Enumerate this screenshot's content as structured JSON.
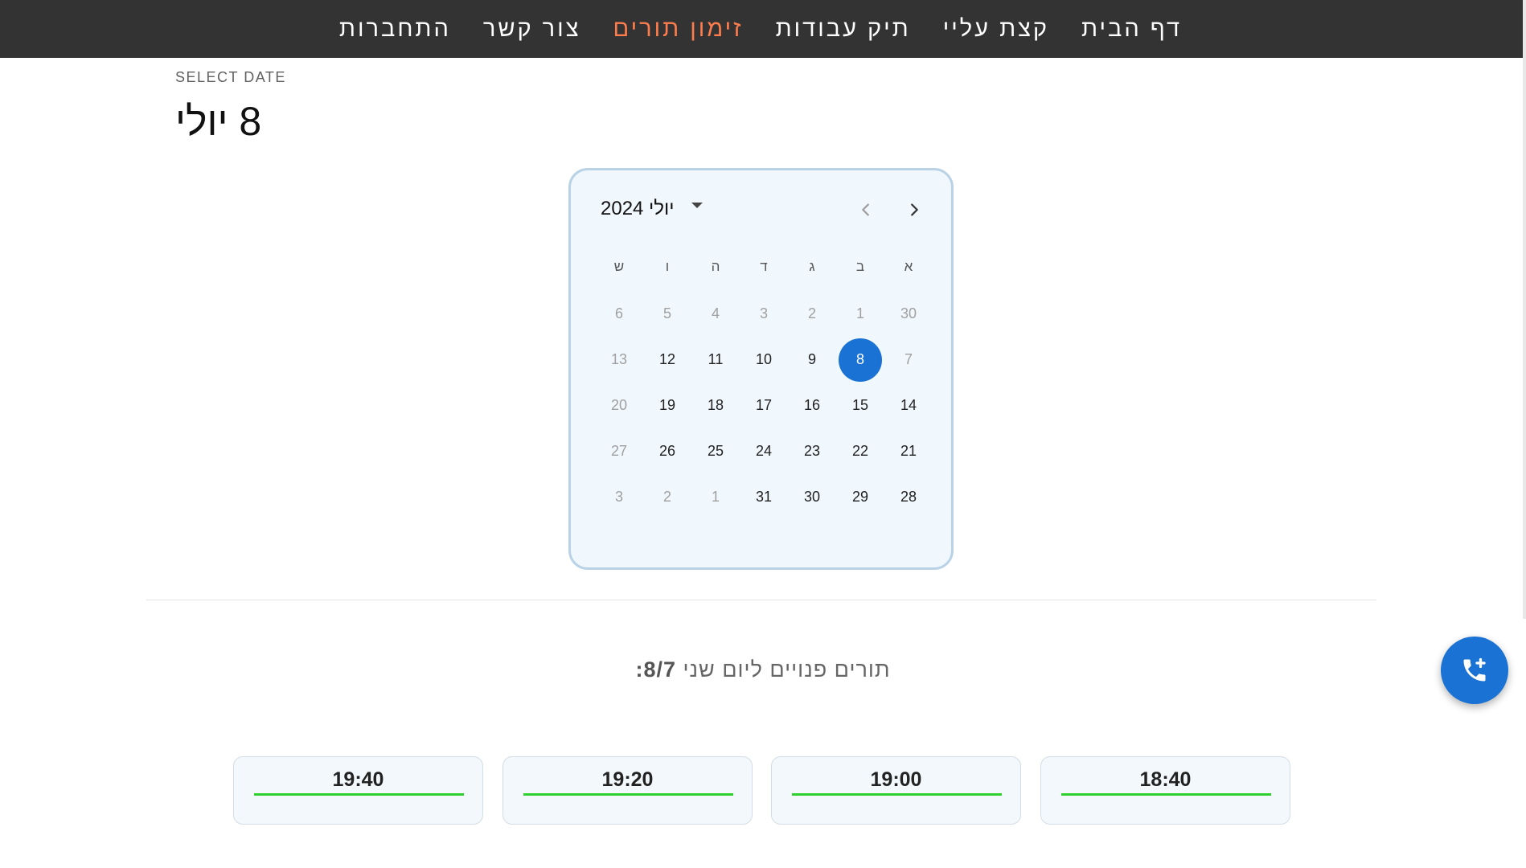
{
  "nav": {
    "items": [
      {
        "label": "דף הבית",
        "active": false
      },
      {
        "label": "קצת עליי",
        "active": false
      },
      {
        "label": "תיק עבודות",
        "active": false
      },
      {
        "label": "זימון תורים",
        "active": true
      },
      {
        "label": "צור קשר",
        "active": false
      },
      {
        "label": "התחברות",
        "active": false
      }
    ],
    "active_color": "#ff7d4d"
  },
  "header": {
    "select_label": "SELECT DATE",
    "selected_date": "8 יולי"
  },
  "calendar": {
    "month_label": "יולי 2024",
    "weekdays": [
      "א",
      "ב",
      "ג",
      "ד",
      "ה",
      "ו",
      "ש"
    ],
    "weeks": [
      [
        {
          "d": "30",
          "m": true
        },
        {
          "d": "1",
          "m": true
        },
        {
          "d": "2",
          "m": true
        },
        {
          "d": "3",
          "m": true
        },
        {
          "d": "4",
          "m": true
        },
        {
          "d": "5",
          "m": true
        },
        {
          "d": "6",
          "m": true
        }
      ],
      [
        {
          "d": "7",
          "m": true
        },
        {
          "d": "8",
          "s": true
        },
        {
          "d": "9"
        },
        {
          "d": "10"
        },
        {
          "d": "11"
        },
        {
          "d": "12"
        },
        {
          "d": "13",
          "m": true
        }
      ],
      [
        {
          "d": "14"
        },
        {
          "d": "15"
        },
        {
          "d": "16"
        },
        {
          "d": "17"
        },
        {
          "d": "18"
        },
        {
          "d": "19"
        },
        {
          "d": "20",
          "m": true
        }
      ],
      [
        {
          "d": "21"
        },
        {
          "d": "22"
        },
        {
          "d": "23"
        },
        {
          "d": "24"
        },
        {
          "d": "25"
        },
        {
          "d": "26"
        },
        {
          "d": "27",
          "m": true
        }
      ],
      [
        {
          "d": "28"
        },
        {
          "d": "29"
        },
        {
          "d": "30"
        },
        {
          "d": "31"
        },
        {
          "d": "1",
          "m": true
        },
        {
          "d": "2",
          "m": true
        },
        {
          "d": "3",
          "m": true
        }
      ]
    ],
    "selected_color": "#1a73d4"
  },
  "slots": {
    "title_prefix": "תורים פנויים ליום שני ",
    "title_date": "8/7",
    "title_suffix": ":",
    "times": [
      "18:40",
      "19:00",
      "19:20",
      "19:40"
    ],
    "bar_color": "#2ed12b"
  },
  "fab": {
    "icon": "phone-add-icon"
  }
}
